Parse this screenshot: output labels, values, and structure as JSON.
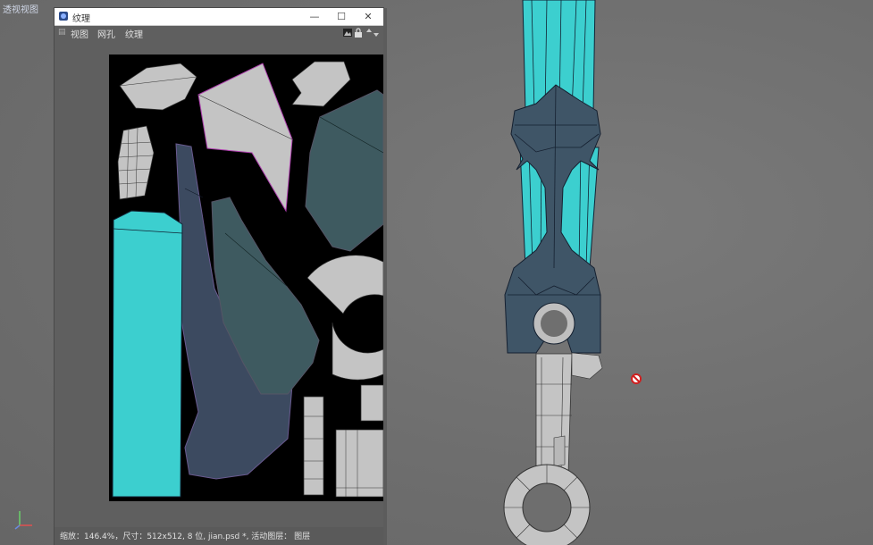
{
  "viewport": {
    "title": "透视视图"
  },
  "texture_window": {
    "title": "纹理",
    "controls": {
      "minimize": "—",
      "maximize": "☐",
      "close": "✕"
    },
    "menu": [
      "视图",
      "网孔",
      "纹理"
    ],
    "status": "缩放：146.4%，尺寸：512x512, 8 位, jian.psd *, 活动图层：  图层"
  },
  "colors": {
    "cyan": "#35c8c8",
    "dark_blue": "#3c4a5f",
    "teal_dark": "#3e5a5f",
    "grey_part": "#bfbfbf",
    "accent_pink": "#c050c0"
  },
  "icons": [
    "app-icon",
    "menu-grip-icon",
    "image-icon",
    "lock-icon",
    "arrows-icon",
    "axis-icon",
    "no-entry-cursor-icon"
  ]
}
